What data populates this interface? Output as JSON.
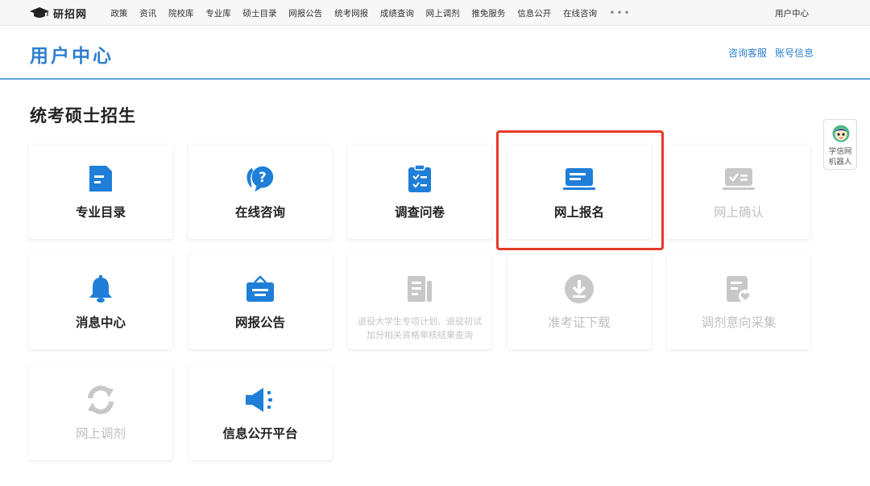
{
  "topnav": {
    "logo_text": "研招网",
    "items": [
      "政策",
      "资讯",
      "院校库",
      "专业库",
      "硕士目录",
      "网报公告",
      "统考网报",
      "成绩查询",
      "网上调剂",
      "推免服务",
      "信息公开",
      "在线咨询"
    ],
    "more": "•••",
    "user_center": "用户中心"
  },
  "header": {
    "title": "用户中心",
    "links": [
      "咨询客服",
      "账号信息"
    ]
  },
  "section": {
    "title": "统考硕士招生"
  },
  "cards": [
    {
      "label": "专业目录",
      "icon": "document-icon",
      "enabled": true
    },
    {
      "label": "在线咨询",
      "icon": "chat-question-icon",
      "enabled": true
    },
    {
      "label": "调查问卷",
      "icon": "clipboard-check-icon",
      "enabled": true
    },
    {
      "label": "网上报名",
      "icon": "laptop-form-icon",
      "enabled": true,
      "highlighted": true
    },
    {
      "label": "网上确认",
      "icon": "card-check-icon",
      "enabled": false
    },
    {
      "label": "消息中心",
      "icon": "bell-icon",
      "enabled": true
    },
    {
      "label": "网报公告",
      "icon": "notice-board-icon",
      "enabled": true
    },
    {
      "label": "退役大学生专项计划、退役初试加分相关资格审核结果查询",
      "icon": "news-icon",
      "enabled": false
    },
    {
      "label": "准考证下载",
      "icon": "download-circle-icon",
      "enabled": false
    },
    {
      "label": "调剂意向采集",
      "icon": "form-heart-icon",
      "enabled": false
    },
    {
      "label": "网上调剂",
      "icon": "refresh-icon",
      "enabled": false
    },
    {
      "label": "信息公开平台",
      "icon": "megaphone-icon",
      "enabled": true
    }
  ],
  "robot": {
    "line1": "学信网",
    "line2": "机器人"
  },
  "colors": {
    "accent": "#2e7fd1",
    "icon_blue": "#1e7ed8",
    "disabled": "#c8c8c8",
    "highlight": "#e53a26"
  }
}
